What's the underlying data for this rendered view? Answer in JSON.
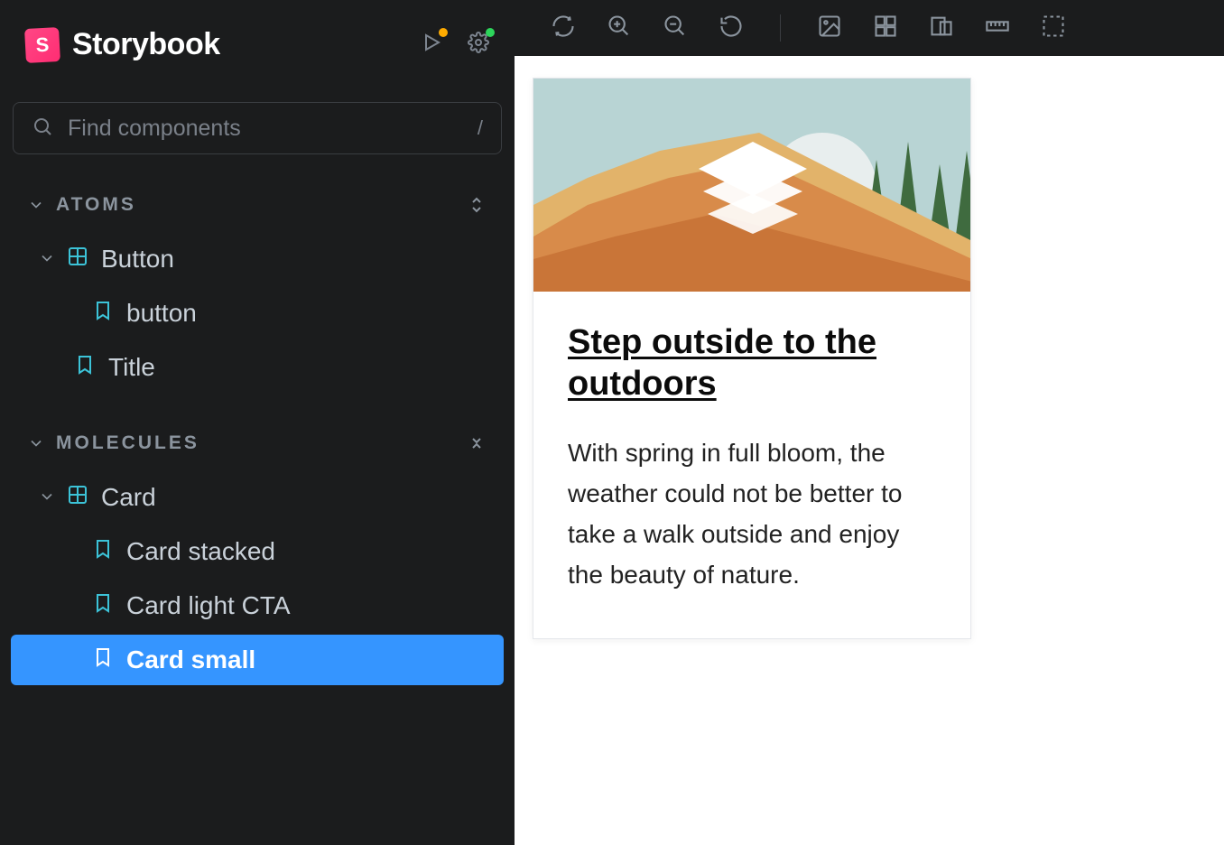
{
  "brand": {
    "name": "Storybook",
    "badge": "S"
  },
  "search": {
    "placeholder": "Find components",
    "shortcut": "/"
  },
  "sections": {
    "atoms": {
      "label": "ATOMS"
    },
    "molecules": {
      "label": "MOLECULES"
    }
  },
  "tree": {
    "button": {
      "label": "Button"
    },
    "button_story": {
      "label": "button"
    },
    "title": {
      "label": "Title"
    },
    "card": {
      "label": "Card"
    },
    "card_stacked": {
      "label": "Card stacked"
    },
    "card_light_cta": {
      "label": "Card light CTA"
    },
    "card_small": {
      "label": "Card small"
    }
  },
  "preview": {
    "card_title": "Step outside to the outdoors",
    "card_text": "With spring in full bloom, the weather could not be better to take a walk outside and enjoy the beauty of nature."
  }
}
